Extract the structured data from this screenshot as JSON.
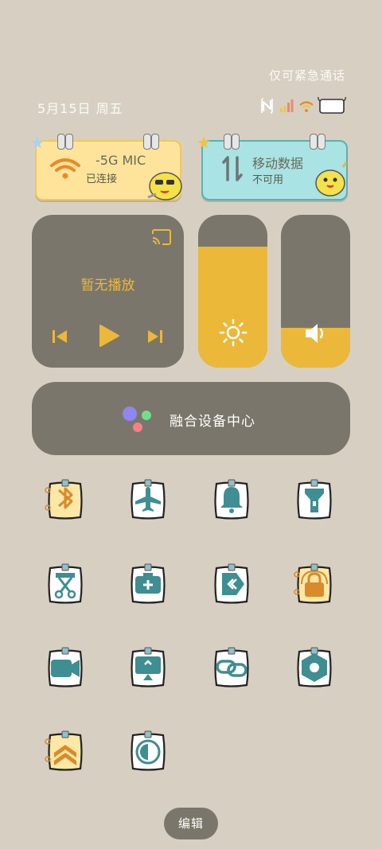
{
  "status": {
    "emergency_only": "仅可紧急通话",
    "date": "5月15日 周五",
    "icons": [
      "nfc-icon",
      "signal-icon",
      "wifi-icon",
      "battery-icon"
    ]
  },
  "tiles": {
    "wifi": {
      "title": "-5G    MIC",
      "subtitle": "已连接",
      "accent": "#fde49a"
    },
    "mobile_data": {
      "title": "移动数据",
      "subtitle": "不可用",
      "accent": "#a9e3e3"
    }
  },
  "media": {
    "title": "暂无播放",
    "accent": "#ebb83a"
  },
  "brightness": {
    "level": 0.79
  },
  "volume": {
    "level": 0.26
  },
  "fusion": {
    "label": "融合设备中心"
  },
  "toggles": [
    {
      "name": "bluetooth",
      "icon": "bluetooth-icon",
      "active": true
    },
    {
      "name": "airplane",
      "icon": "airplane-icon",
      "active": false
    },
    {
      "name": "notification",
      "icon": "bell-icon",
      "active": false
    },
    {
      "name": "flashlight",
      "icon": "flashlight-icon",
      "active": false
    },
    {
      "name": "screenshot",
      "icon": "scissors-icon",
      "active": false
    },
    {
      "name": "battery-saver",
      "icon": "battery-plus-icon",
      "active": false
    },
    {
      "name": "share",
      "icon": "share-icon",
      "active": false
    },
    {
      "name": "rotation-lock",
      "icon": "rotation-lock-icon",
      "active": true
    },
    {
      "name": "screen-record",
      "icon": "video-icon",
      "active": false
    },
    {
      "name": "screen-cast",
      "icon": "cast-icon",
      "active": false
    },
    {
      "name": "hotspot",
      "icon": "link-icon",
      "active": false
    },
    {
      "name": "nfc",
      "icon": "nfc-hex-icon",
      "active": false
    },
    {
      "name": "performance",
      "icon": "chevrons-up-icon",
      "active": true
    },
    {
      "name": "dark-mode",
      "icon": "dark-mode-icon",
      "active": false
    }
  ],
  "edit_label": "编辑"
}
